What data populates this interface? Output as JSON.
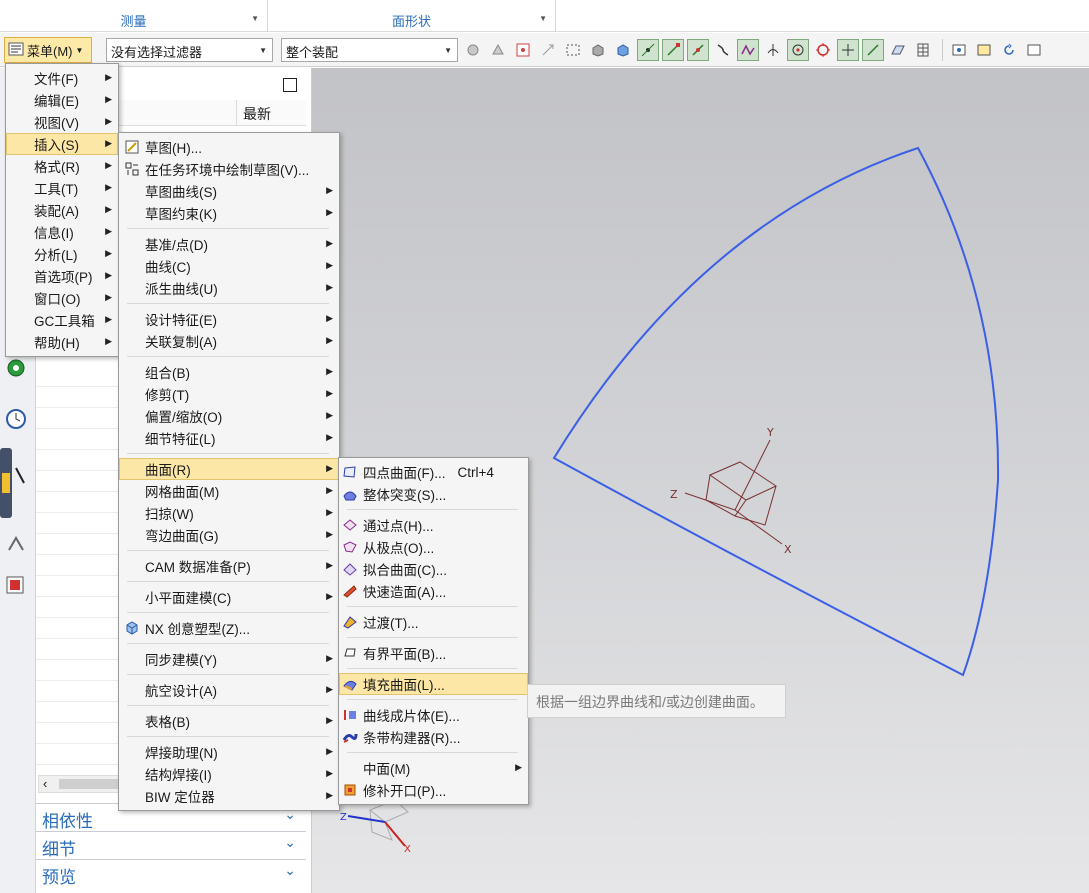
{
  "ribbon": {
    "groups": [
      {
        "label": "测量"
      },
      {
        "label": "面形状"
      }
    ]
  },
  "toolbar": {
    "menu_label": "菜单(M)",
    "filter_value": "没有选择过滤器",
    "assembly_value": "整个装配"
  },
  "navigator": {
    "column_header": "最新",
    "sections": [
      "相依性",
      "细节",
      "预览"
    ]
  },
  "main_menu": {
    "items": [
      {
        "label": "文件(F)"
      },
      {
        "label": "编辑(E)"
      },
      {
        "label": "视图(V)"
      },
      {
        "label": "插入(S)"
      },
      {
        "label": "格式(R)"
      },
      {
        "label": "工具(T)"
      },
      {
        "label": "装配(A)"
      },
      {
        "label": "信息(I)"
      },
      {
        "label": "分析(L)"
      },
      {
        "label": "首选项(P)"
      },
      {
        "label": "窗口(O)"
      },
      {
        "label": "GC工具箱"
      },
      {
        "label": "帮助(H)"
      }
    ]
  },
  "insert_menu": {
    "groups": [
      [
        {
          "label": "草图(H)...",
          "icon": "sketch-icon"
        },
        {
          "label": "在任务环境中绘制草图(V)...",
          "icon": "sketch-task-icon"
        },
        {
          "label": "草图曲线(S)"
        },
        {
          "label": "草图约束(K)"
        }
      ],
      [
        {
          "label": "基准/点(D)"
        },
        {
          "label": "曲线(C)"
        },
        {
          "label": "派生曲线(U)"
        }
      ],
      [
        {
          "label": "设计特征(E)"
        },
        {
          "label": "关联复制(A)"
        }
      ],
      [
        {
          "label": "组合(B)"
        },
        {
          "label": "修剪(T)"
        },
        {
          "label": "偏置/缩放(O)"
        },
        {
          "label": "细节特征(L)"
        }
      ],
      [
        {
          "label": "曲面(R)"
        },
        {
          "label": "网格曲面(M)"
        },
        {
          "label": "扫掠(W)"
        },
        {
          "label": "弯边曲面(G)"
        }
      ],
      [
        {
          "label": "CAM 数据准备(P)"
        }
      ],
      [
        {
          "label": "小平面建模(C)"
        }
      ],
      [
        {
          "label": "NX 创意塑型(Z)...",
          "icon": "nx-realize-shape-icon"
        }
      ],
      [
        {
          "label": "同步建模(Y)"
        }
      ],
      [
        {
          "label": "航空设计(A)"
        }
      ],
      [
        {
          "label": "表格(B)"
        }
      ],
      [
        {
          "label": "焊接助理(N)"
        },
        {
          "label": "结构焊接(I)"
        },
        {
          "label": "BIW 定位器"
        }
      ]
    ]
  },
  "surface_menu": {
    "groups": [
      [
        {
          "label": "四点曲面(F)...",
          "accel": "Ctrl+4",
          "icon": "four-point-surface-icon"
        },
        {
          "label": "整体突变(S)...",
          "icon": "global-shaping-icon"
        }
      ],
      [
        {
          "label": "通过点(H)...",
          "icon": "through-points-icon"
        },
        {
          "label": "从极点(O)...",
          "icon": "from-poles-icon"
        },
        {
          "label": "拟合曲面(C)...",
          "icon": "fit-surface-icon"
        },
        {
          "label": "快速造面(A)...",
          "icon": "rapid-surfacing-icon"
        }
      ],
      [
        {
          "label": "过渡(T)...",
          "icon": "transition-icon"
        }
      ],
      [
        {
          "label": "有界平面(B)...",
          "icon": "bounded-plane-icon"
        }
      ],
      [
        {
          "label": "填充曲面(L)...",
          "icon": "fill-surface-icon"
        }
      ],
      [
        {
          "label": "曲线成片体(E)...",
          "icon": "curves-to-sheet-icon"
        },
        {
          "label": "条带构建器(R)...",
          "icon": "ribbon-builder-icon"
        }
      ],
      [
        {
          "label": "中面(M)"
        },
        {
          "label": "修补开口(P)...",
          "icon": "patch-openings-icon"
        }
      ]
    ]
  },
  "tooltip": {
    "text": "根据一组边界曲线和/或边创建曲面。"
  },
  "triad": {
    "x": "X",
    "y": "Y",
    "z": "Z"
  },
  "colors": {
    "curve": "#3a5fe6",
    "highlight": "#fde7a6",
    "ribbon_label": "#2a6cb8"
  }
}
